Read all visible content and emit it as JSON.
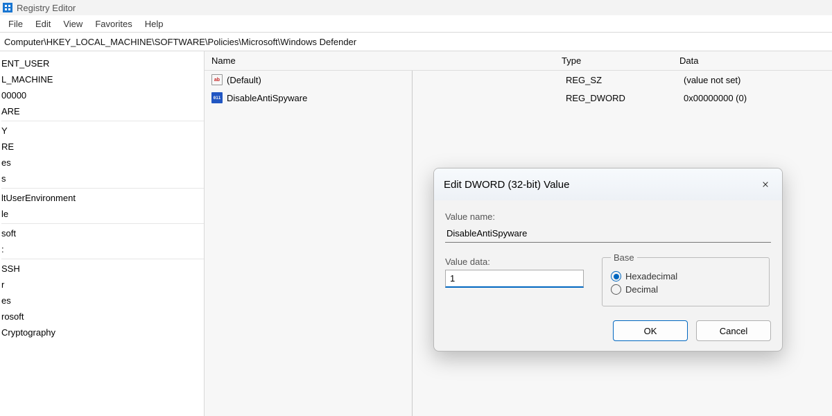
{
  "window": {
    "title": "Registry Editor"
  },
  "menu": {
    "file": "File",
    "edit": "Edit",
    "view": "View",
    "favorites": "Favorites",
    "help": "Help"
  },
  "address": "Computer\\HKEY_LOCAL_MACHINE\\SOFTWARE\\Policies\\Microsoft\\Windows Defender",
  "tree": {
    "items": [
      "ENT_USER",
      "L_MACHINE",
      "00000",
      "ARE",
      "",
      "Y",
      "RE",
      "es",
      "s",
      "",
      "ltUserEnvironment",
      "le",
      "",
      "soft",
      ":",
      "",
      "SSH",
      "r",
      "es",
      "rosoft",
      "Cryptography"
    ]
  },
  "list": {
    "headers": {
      "name": "Name",
      "type": "Type",
      "data": "Data"
    },
    "rows": [
      {
        "icon": "ab",
        "name": "(Default)",
        "type": "REG_SZ",
        "data": "(value not set)"
      },
      {
        "icon": "011",
        "name": "DisableAntiSpyware",
        "type": "REG_DWORD",
        "data": "0x00000000 (0)"
      }
    ]
  },
  "dialog": {
    "title": "Edit DWORD (32-bit) Value",
    "value_name_label": "Value name:",
    "value_name": "DisableAntiSpyware",
    "value_data_label": "Value data:",
    "value_data": "1",
    "base_label": "Base",
    "hex_label": "Hexadecimal",
    "dec_label": "Decimal",
    "base": "hex",
    "ok": "OK",
    "cancel": "Cancel"
  }
}
